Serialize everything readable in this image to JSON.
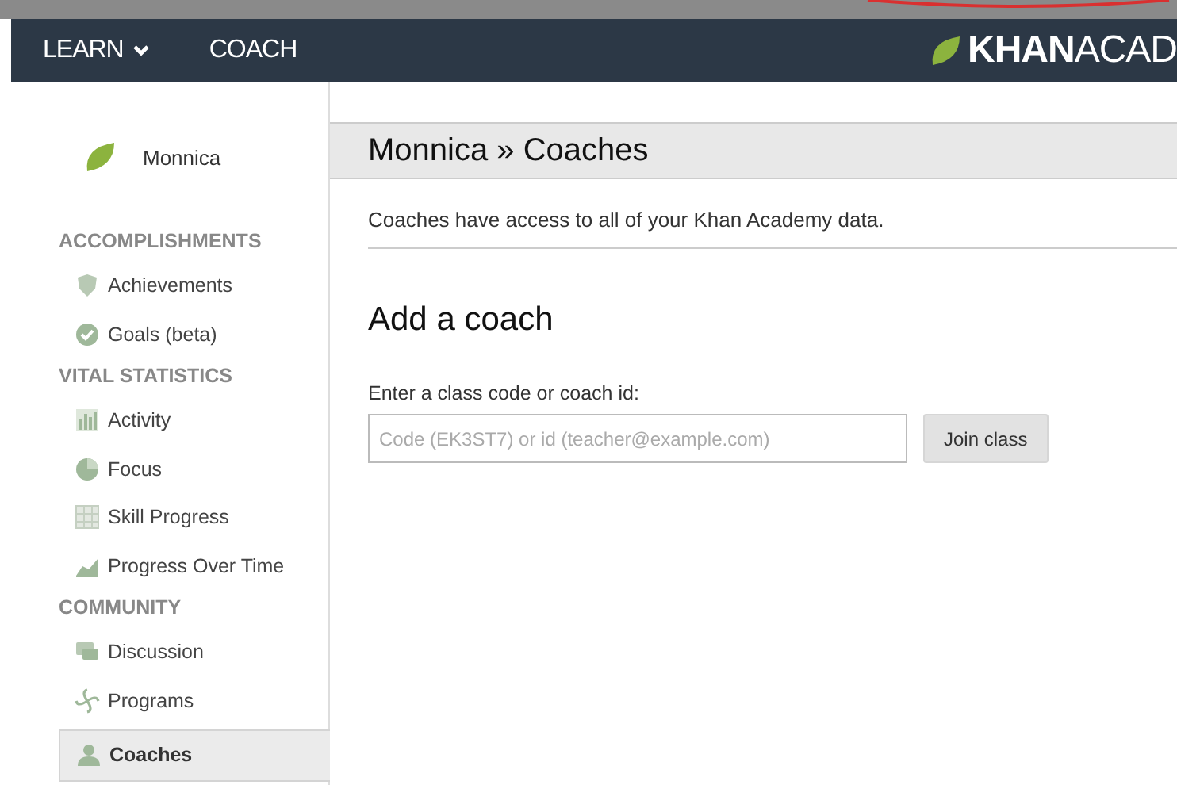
{
  "nav": {
    "items": [
      {
        "label": "LEARN",
        "dropdown": true
      },
      {
        "label": "COACH",
        "dropdown": false
      }
    ],
    "logo": "**KHAN**ACAD"
  },
  "sidebar": {
    "user": "Monnica",
    "items": [
      {
        "kind": "heading",
        "label": "ACCOMPLISHMENTS"
      },
      {
        "kind": "link",
        "label": "Achievements",
        "selected": false
      },
      {
        "kind": "link",
        "label": "Goals (beta)",
        "selected": false
      },
      {
        "kind": "heading",
        "label": "VITAL STATISTICS"
      },
      {
        "kind": "link",
        "label": "Activity",
        "selected": false
      },
      {
        "kind": "link",
        "label": "Focus",
        "selected": false
      },
      {
        "kind": "link",
        "label": "Skill Progress",
        "selected": false
      },
      {
        "kind": "link",
        "label": "Progress Over Time",
        "selected": false
      },
      {
        "kind": "heading",
        "label": "COMMUNITY"
      },
      {
        "kind": "link",
        "label": "Discussion",
        "selected": false
      },
      {
        "kind": "link",
        "label": "Programs",
        "selected": false
      },
      {
        "kind": "link",
        "label": "Coaches",
        "selected": true
      }
    ]
  },
  "main": {
    "title": "Monnica » Coaches",
    "intro": "Coaches have access to all of your Khan Academy data.",
    "section_title": "Add a coach",
    "field_label": "Enter a class code or coach id:",
    "field": {
      "placeholder": "Code (EK3ST7) or id (teacher@example.com)"
    },
    "button": "Join class"
  }
}
